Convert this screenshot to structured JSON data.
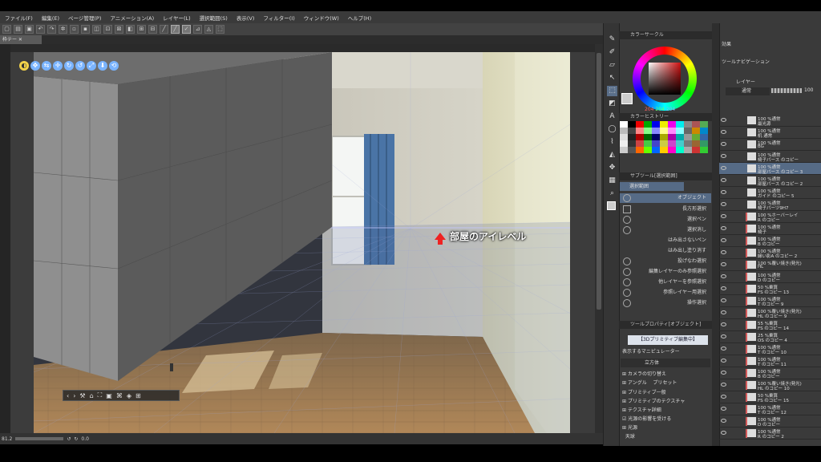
{
  "menu": [
    "ファイル(F)",
    "編集(E)",
    "ページ管理(P)",
    "アニメーション(A)",
    "レイヤー(L)",
    "選択範囲(S)",
    "表示(V)",
    "フィルター(I)",
    "ウィンドウ(W)",
    "ヘルプ(H)"
  ],
  "document_tab": "枠テー",
  "canvas_annotation": "部屋のアイレベル",
  "status": {
    "left": "81.2",
    "angle": "0.0"
  },
  "color_panel": {
    "title": "カラーサークル",
    "r": "204",
    "g": "204",
    "b": "204"
  },
  "color_history_title": "カラーヒストリー",
  "subtool": {
    "title": "サブツール[選択範囲]",
    "group": "選択範囲",
    "items": [
      "オブジェクト",
      "長方形選択",
      "選択ペン",
      "選択消し",
      "はみ出さないペン",
      "はみ出し塗り消す",
      "投げなわ選択",
      "編集レイヤーのみ参照選択",
      "他レイヤーを参照選択",
      "参照レイヤー用選択",
      "操作選択"
    ]
  },
  "tool_property": {
    "title": "ツールプロパティ[オブジェクト]",
    "mode_banner": "【3Dプリミティブ編集中】",
    "display_label": "表示するマニピュレーター",
    "primitive": "立方体",
    "items": [
      "カメラの切り替え",
      "アングル",
      "プリセット",
      "プリミティブ一般",
      "プリミティブのテクスチャ",
      "テクスチャ詳細",
      "光源の影響を受ける",
      "光源",
      "天球"
    ]
  },
  "right_panel": {
    "effects_label": "効果",
    "navigator_label": "ツールナビゲーション",
    "layer_tab": "レイヤー",
    "blend_mode": "通常",
    "opacity": "100"
  },
  "layers": [
    {
      "l1": "100 %通常",
      "l2": "最光源"
    },
    {
      "l1": "100 %通常",
      "l2": "机 通常"
    },
    {
      "l1": "100 %通常",
      "l2": "BG"
    },
    {
      "l1": "100 %通常",
      "l2": "椅子パース のコピー"
    },
    {
      "l1": "100 %通常",
      "l2": "部屋パース のコピー 3",
      "selected": true
    },
    {
      "l1": "100 %通常",
      "l2": "部屋パース のコピー 2"
    },
    {
      "l1": "100 %通常",
      "l2": "ガイド のコピー 5"
    },
    {
      "l1": "100 %通常",
      "l2": "椅子パーツ9H7"
    },
    {
      "l1": "100 %ホーバーレイ",
      "l2": "R のコピー"
    },
    {
      "l1": "100 %通常",
      "l2": "椅子"
    },
    {
      "l1": "100 %通常",
      "l2": "B のコピー"
    },
    {
      "l1": "100 %通常",
      "l2": "縁い影A のコピー 2"
    },
    {
      "l1": "100 %覆い焼き(発光)",
      "l2": "HL"
    },
    {
      "l1": "100 %通常",
      "l2": "D のコピー"
    },
    {
      "l1": "50 %乗算",
      "l2": "FS のコピー 13"
    },
    {
      "l1": "100 %通常",
      "l2": "T のコピー 9"
    },
    {
      "l1": "100 %覆い焼き(発光)",
      "l2": "HL のコピー 9"
    },
    {
      "l1": "55 %乗算",
      "l2": "FS のコピー 14"
    },
    {
      "l1": "25 %乗算",
      "l2": "OS のコピー 4"
    },
    {
      "l1": "100 %通常",
      "l2": "T のコピー 10"
    },
    {
      "l1": "100 %通常",
      "l2": "T のコピー 11"
    },
    {
      "l1": "100 %通常",
      "l2": "B のコピー"
    },
    {
      "l1": "100 %覆い焼き(発光)",
      "l2": "HL のコピー 10"
    },
    {
      "l1": "50 %乗算",
      "l2": "FS のコピー 15"
    },
    {
      "l1": "100 %通常",
      "l2": "T のコピー 12"
    },
    {
      "l1": "100 %通常",
      "l2": "D のコピー"
    },
    {
      "l1": "100 %通常",
      "l2": "R のコピー 2"
    }
  ]
}
